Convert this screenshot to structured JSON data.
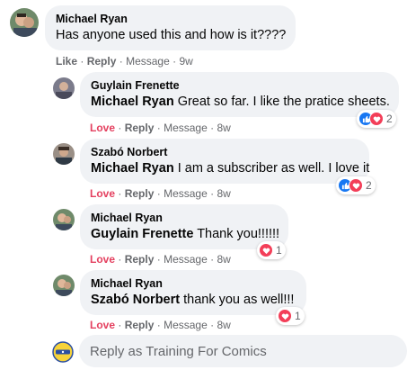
{
  "comments": [
    {
      "author": "Michael Ryan",
      "mention": "",
      "text": "Has anyone used this and how is it????",
      "reaction_label": "Like",
      "reply_label": "Reply",
      "message_label": "Message",
      "time": "9w",
      "reaction_count": ""
    },
    {
      "author": "Guylain Frenette",
      "mention": "Michael Ryan",
      "text": " Great so far. I like the pratice sheets.",
      "reaction_label": "Love",
      "reply_label": "Reply",
      "message_label": "Message",
      "time": "8w",
      "reaction_count": "2"
    },
    {
      "author": "Szabó Norbert",
      "mention": "Michael Ryan",
      "text": " I am a subscriber as well. I love it",
      "reaction_label": "Love",
      "reply_label": "Reply",
      "message_label": "Message",
      "time": "8w",
      "reaction_count": "2"
    },
    {
      "author": "Michael Ryan",
      "mention": "Guylain Frenette",
      "text": " Thank you!!!!!!",
      "reaction_label": "Love",
      "reply_label": "Reply",
      "message_label": "Message",
      "time": "8w",
      "reaction_count": "1"
    },
    {
      "author": "Michael Ryan",
      "mention": "Szabó Norbert",
      "text": " thank you as well!!!",
      "reaction_label": "Love",
      "reply_label": "Reply",
      "message_label": "Message",
      "time": "8w",
      "reaction_count": "1"
    }
  ],
  "separator": "·",
  "reply_box": {
    "placeholder": "Reply as Training For Comics"
  },
  "colors": {
    "bubble": "#f0f2f5",
    "love": "#e4405f",
    "like_blue": "#1877f2",
    "love_red": "#f33e58",
    "meta": "#65676b"
  }
}
